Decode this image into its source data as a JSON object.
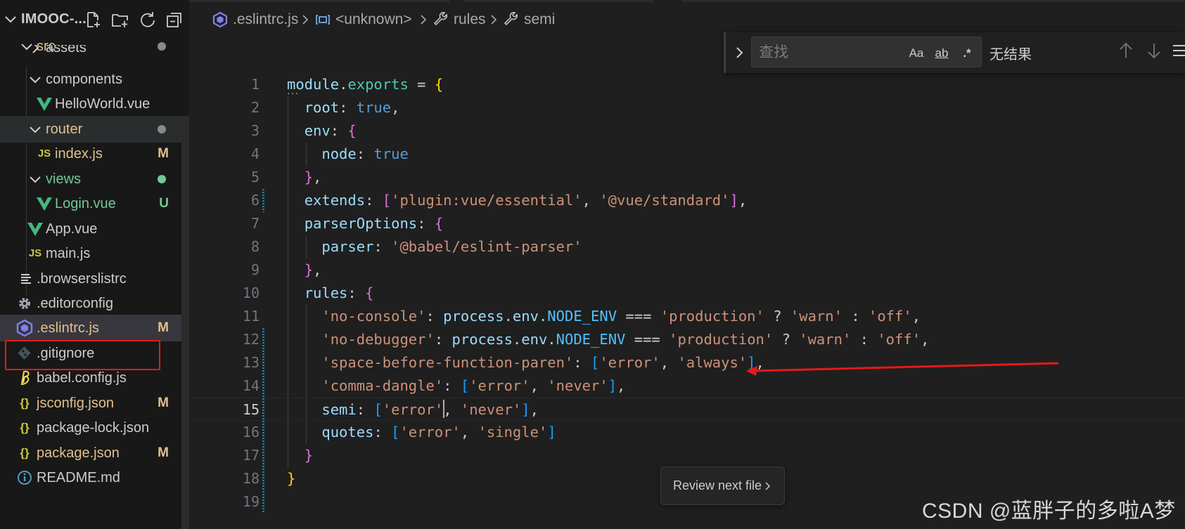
{
  "colors": {
    "sidebar_bg": "#181818",
    "editor_bg": "#1f1f1f",
    "modified": "#e2c08d",
    "untracked": "#73c991",
    "annotation_red": "#e81818",
    "vue_green": "#41b883",
    "js_yellow": "#cbcb41",
    "eslint_purple": "#8080f2"
  },
  "explorer": {
    "title": "IMOOC-...",
    "actions": [
      {
        "name": "new-file-icon"
      },
      {
        "name": "new-folder-icon"
      },
      {
        "name": "refresh-icon"
      },
      {
        "name": "collapse-all-icon"
      }
    ],
    "items": [
      {
        "label": "src",
        "type": "folder",
        "expanded": true,
        "status": "dot",
        "color": "#e2c08d"
      },
      {
        "label": "assets",
        "type": "folder",
        "expanded": false,
        "status": "",
        "color": "#cccccc"
      },
      {
        "label": "components",
        "type": "folder",
        "expanded": true,
        "status": "",
        "color": "#cccccc"
      },
      {
        "label": "HelloWorld.vue",
        "type": "vue",
        "status": "",
        "color": "#cccccc"
      },
      {
        "label": "router",
        "type": "folder",
        "expanded": true,
        "status": "dot",
        "color": "#e2c08d"
      },
      {
        "label": "index.js",
        "type": "js",
        "status": "M",
        "color": "#e2c08d"
      },
      {
        "label": "views",
        "type": "folder",
        "expanded": true,
        "status": "dot",
        "color": "#73c991"
      },
      {
        "label": "Login.vue",
        "type": "vue",
        "status": "U",
        "color": "#73c991"
      },
      {
        "label": "App.vue",
        "type": "vue",
        "status": "",
        "color": "#cccccc"
      },
      {
        "label": "main.js",
        "type": "js",
        "status": "",
        "color": "#cccccc"
      },
      {
        "label": ".browserslistrc",
        "type": "lines",
        "status": "",
        "color": "#cccccc"
      },
      {
        "label": ".editorconfig",
        "type": "gear",
        "status": "",
        "color": "#cccccc"
      },
      {
        "label": ".eslintrc.js",
        "type": "eslint",
        "status": "M",
        "color": "#e2c08d"
      },
      {
        "label": ".gitignore",
        "type": "git",
        "status": "",
        "color": "#cccccc"
      },
      {
        "label": "babel.config.js",
        "type": "babel",
        "status": "",
        "color": "#cccccc"
      },
      {
        "label": "jsconfig.json",
        "type": "json",
        "status": "M",
        "color": "#e2c08d"
      },
      {
        "label": "package-lock.json",
        "type": "json",
        "status": "",
        "color": "#cccccc"
      },
      {
        "label": "package.json",
        "type": "json",
        "status": "M",
        "color": "#e2c08d"
      },
      {
        "label": "README.md",
        "type": "info",
        "status": "",
        "color": "#cccccc"
      }
    ],
    "js_icon_text": "JS",
    "json_icon_text": "{}"
  },
  "breadcrumb": {
    "file": ".eslintrc.js",
    "unknown": "<unknown>",
    "rules": "rules",
    "semi": "semi"
  },
  "find": {
    "placeholder": "查找",
    "match_case": "Aa",
    "whole_word": "ab",
    "regex": ".*",
    "result": "无结果"
  },
  "code": {
    "active_line": 15,
    "lines": [
      "module.exports = {",
      "  root: true,",
      "  env: {",
      "    node: true",
      "  },",
      "  extends: ['plugin:vue/essential', '@vue/standard'],",
      "  parserOptions: {",
      "    parser: '@babel/eslint-parser'",
      "  },",
      "  rules: {",
      "    'no-console': process.env.NODE_ENV === 'production' ? 'warn' : 'off',",
      "    'no-debugger': process.env.NODE_ENV === 'production' ? 'warn' : 'off',",
      "    'space-before-function-paren': ['error', 'always'],",
      "    'comma-dangle': ['error', 'never'],",
      "    semi: ['error', 'never'],",
      "    quotes: ['error', 'single']",
      "  }",
      "}",
      ""
    ]
  },
  "review_button": "Review next file",
  "watermark": "CSDN @蓝胖子的多啦A梦"
}
